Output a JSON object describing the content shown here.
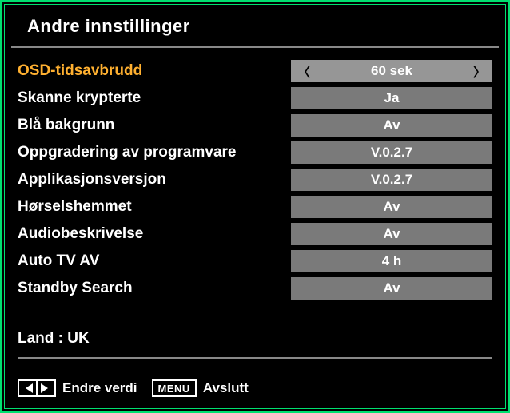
{
  "title": "Andre innstillinger",
  "settings": [
    {
      "label": "OSD-tidsavbrudd",
      "value": "60 sek",
      "highlighted": true,
      "selected": true,
      "arrows": true
    },
    {
      "label": "Skanne krypterte",
      "value": "Ja",
      "highlighted": false,
      "selected": false,
      "arrows": false
    },
    {
      "label": "Blå bakgrunn",
      "value": "Av",
      "highlighted": false,
      "selected": false,
      "arrows": false
    },
    {
      "label": "Oppgradering av programvare",
      "value": "V.0.2.7",
      "highlighted": false,
      "selected": false,
      "arrows": false
    },
    {
      "label": "Applikasjonsversjon",
      "value": "V.0.2.7",
      "highlighted": false,
      "selected": false,
      "arrows": false
    },
    {
      "label": "Hørselshemmet",
      "value": "Av",
      "highlighted": false,
      "selected": false,
      "arrows": false
    },
    {
      "label": "Audiobeskrivelse",
      "value": "Av",
      "highlighted": false,
      "selected": false,
      "arrows": false
    },
    {
      "label": "Auto TV AV",
      "value": "4 h",
      "highlighted": false,
      "selected": false,
      "arrows": false
    },
    {
      "label": "Standby Search",
      "value": "Av",
      "highlighted": false,
      "selected": false,
      "arrows": false
    }
  ],
  "country": "Land : UK",
  "footer": {
    "change_value": "Endre verdi",
    "menu_label": "MENU",
    "exit": "Avslutt"
  }
}
